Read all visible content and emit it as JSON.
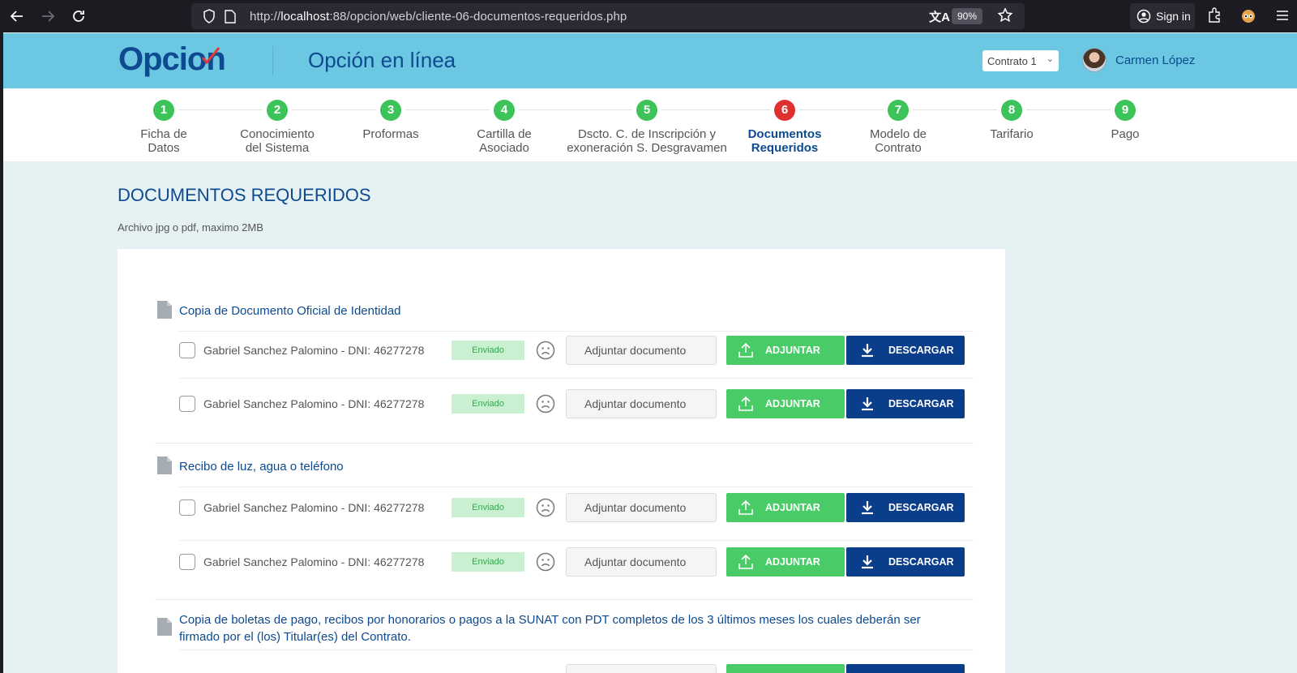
{
  "browser": {
    "url_prefix": "http://",
    "url_host": "localhost",
    "url_rest": ":88/opcion/web/cliente-06-documentos-requeridos.php",
    "zoom": "90%",
    "sign_in": "Sign in"
  },
  "header": {
    "logo": "Opcion",
    "title": "Opción en línea",
    "contract_selected": "Contrato 1",
    "user_name": "Carmen López"
  },
  "steps": [
    {
      "num": "1",
      "label": "Ficha de Datos",
      "active": false
    },
    {
      "num": "2",
      "label": "Conocimiento del Sistema",
      "active": false
    },
    {
      "num": "3",
      "label": "Proformas",
      "active": false
    },
    {
      "num": "4",
      "label": "Cartilla de Asociado",
      "active": false
    },
    {
      "num": "5",
      "label": "Dscto. C. de Inscripción y exoneración S. Desgravamen",
      "active": false
    },
    {
      "num": "6",
      "label": "Documentos Requeridos",
      "active": true
    },
    {
      "num": "7",
      "label": "Modelo de Contrato",
      "active": false
    },
    {
      "num": "8",
      "label": "Tarifario",
      "active": false
    },
    {
      "num": "9",
      "label": "Pago",
      "active": false
    }
  ],
  "page": {
    "title": "DOCUMENTOS REQUERIDOS",
    "subtitle": "Archivo jpg o pdf, maximo 2MB"
  },
  "groups": [
    {
      "title": "Copia de Documento Oficial de Identidad",
      "rows": [
        {
          "person": "Gabriel Sanchez Palomino - DNI: 46277278",
          "status": "Enviado",
          "file_placeholder": "Adjuntar documento",
          "upload_label": "ADJUNTAR",
          "download_label": "DESCARGAR"
        },
        {
          "person": "Gabriel Sanchez Palomino - DNI: 46277278",
          "status": "Enviado",
          "file_placeholder": "Adjuntar documento",
          "upload_label": "ADJUNTAR",
          "download_label": "DESCARGAR"
        }
      ]
    },
    {
      "title": "Recibo de luz, agua o teléfono",
      "rows": [
        {
          "person": "Gabriel Sanchez Palomino - DNI: 46277278",
          "status": "Enviado",
          "file_placeholder": "Adjuntar documento",
          "upload_label": "ADJUNTAR",
          "download_label": "DESCARGAR"
        },
        {
          "person": "Gabriel Sanchez Palomino - DNI: 46277278",
          "status": "Enviado",
          "file_placeholder": "Adjuntar documento",
          "upload_label": "ADJUNTAR",
          "download_label": "DESCARGAR"
        }
      ]
    },
    {
      "title": "Copia de boletas de pago, recibos por honorarios o pagos a la SUNAT con PDT completos de los 3 últimos meses los cuales deberán ser firmado por el (los) Titular(es) del Contrato.",
      "rows": []
    }
  ],
  "colors": {
    "header_bg": "#6cc7e2",
    "brand_blue": "#0d4a8f",
    "step_green": "#3cc45a",
    "step_active_red": "#e03131",
    "upload_green": "#49cc67",
    "download_navy": "#0a3d8a",
    "badge_bg": "#c9f0d0"
  }
}
